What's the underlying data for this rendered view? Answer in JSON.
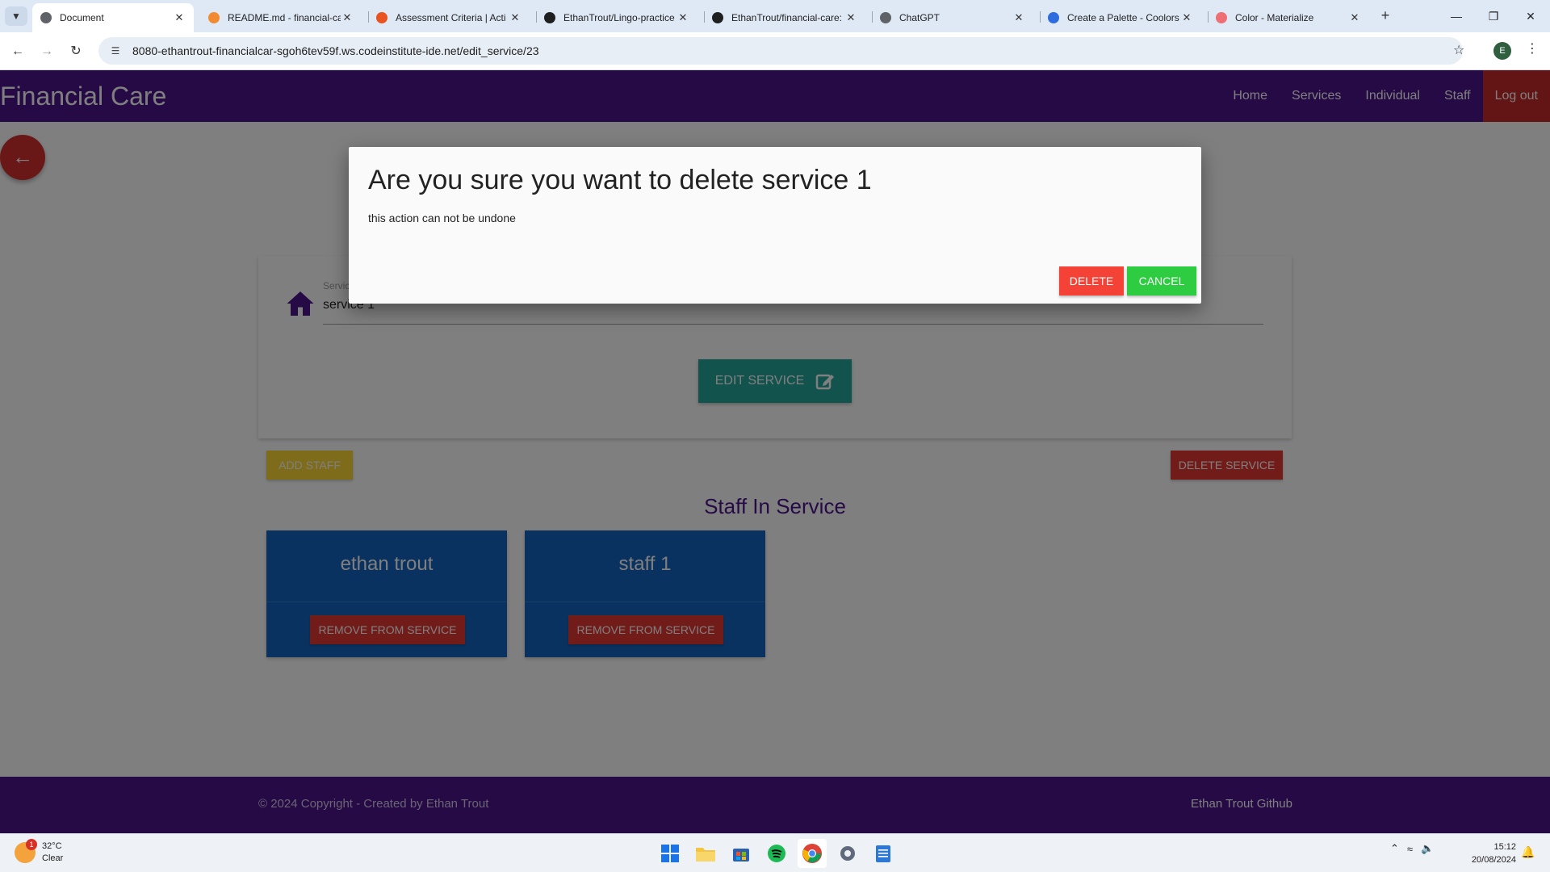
{
  "browser": {
    "tabs": [
      {
        "label": "Document",
        "active": true,
        "icon": "globe-icon",
        "color": "#5f6368"
      },
      {
        "label": "README.md - financial-ca",
        "active": false,
        "icon": "gitpod-icon",
        "color": "#f28b30"
      },
      {
        "label": "Assessment Criteria | Acti",
        "active": false,
        "icon": "circle-icon",
        "color": "#e8531f"
      },
      {
        "label": "EthanTrout/Lingo-practice",
        "active": false,
        "icon": "github-icon",
        "color": "#1f1f1f"
      },
      {
        "label": "EthanTrout/financial-care:",
        "active": false,
        "icon": "github-icon",
        "color": "#1f1f1f"
      },
      {
        "label": "ChatGPT",
        "active": false,
        "icon": "chatgpt-icon",
        "color": "#5f6368"
      },
      {
        "label": "Create a Palette - Coolors",
        "active": false,
        "icon": "coolors-icon",
        "color": "#2d6cdf"
      },
      {
        "label": "Color - Materialize",
        "active": false,
        "icon": "materialize-icon",
        "color": "#ee6e73"
      }
    ],
    "url": "8080-ethantrout-financialcar-sgoh6tev59f.ws.codeinstitute-ide.net/edit_service/23",
    "profile_initial": "E"
  },
  "site": {
    "brand": "Financial Care",
    "nav": [
      "Home",
      "Services",
      "Individual",
      "Staff"
    ],
    "logout": "Log out",
    "colors": {
      "primary": "#4a148c",
      "accent_red": "#e53935",
      "teal": "#26a69a",
      "yellow": "#fdd835",
      "blue": "#1565c0"
    }
  },
  "service_form": {
    "label": "Service Name",
    "value": "service 1",
    "edit_button": "EDIT SERVICE"
  },
  "actions": {
    "add_staff": "ADD STAFF",
    "delete_service": "DELETE SERVICE"
  },
  "staff_section": {
    "heading": "Staff In Service",
    "members": [
      {
        "name": "ethan trout",
        "button": "REMOVE FROM SERVICE"
      },
      {
        "name": "staff 1",
        "button": "REMOVE FROM SERVICE"
      }
    ]
  },
  "footer": {
    "copyright": "© 2024 Copyright - Created by Ethan Trout",
    "github": "Ethan Trout Github"
  },
  "modal": {
    "title": "Are you sure you want to delete service 1",
    "text": "this action can not be undone",
    "delete": "DELETE",
    "cancel": "CANCEL"
  },
  "taskbar": {
    "weather_badge": "1",
    "temperature": "32°C",
    "condition": "Clear",
    "time": "15:12",
    "date": "20/08/2024",
    "apps": [
      "windows-start-icon",
      "file-explorer-icon",
      "store-icon",
      "spotify-icon",
      "chrome-icon",
      "settings-icon",
      "notepad-icon"
    ]
  }
}
